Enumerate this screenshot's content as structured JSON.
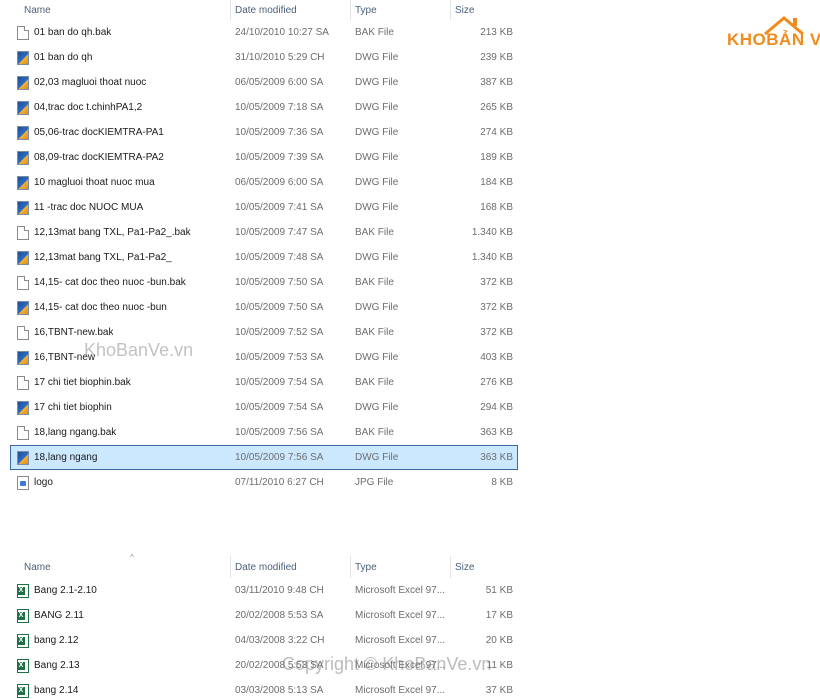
{
  "columns": {
    "name": "Name",
    "date": "Date modified",
    "type": "Type",
    "size": "Size"
  },
  "top_files": [
    {
      "name": "01 ban do qh.bak",
      "date": "24/10/2010 10:27 SA",
      "type": "BAK File",
      "size": "213 KB",
      "icon": "file"
    },
    {
      "name": "01 ban do qh",
      "date": "31/10/2010 5:29 CH",
      "type": "DWG File",
      "size": "239 KB",
      "icon": "dwg"
    },
    {
      "name": "02,03 magluoi thoat nuoc",
      "date": "06/05/2009 6:00 SA",
      "type": "DWG File",
      "size": "387 KB",
      "icon": "dwg"
    },
    {
      "name": "04,trac doc t.chinhPA1,2",
      "date": "10/05/2009 7:18 SA",
      "type": "DWG File",
      "size": "265 KB",
      "icon": "dwg"
    },
    {
      "name": "05,06-trac docKIEMTRA-PA1",
      "date": "10/05/2009 7:36 SA",
      "type": "DWG File",
      "size": "274 KB",
      "icon": "dwg"
    },
    {
      "name": "08,09-trac docKIEMTRA-PA2",
      "date": "10/05/2009 7:39 SA",
      "type": "DWG File",
      "size": "189 KB",
      "icon": "dwg"
    },
    {
      "name": "10 magluoi thoat nuoc mua",
      "date": "06/05/2009 6:00 SA",
      "type": "DWG File",
      "size": "184 KB",
      "icon": "dwg"
    },
    {
      "name": "11 -trac doc NUOC MUA",
      "date": "10/05/2009 7:41 SA",
      "type": "DWG File",
      "size": "168 KB",
      "icon": "dwg"
    },
    {
      "name": "12,13mat bang TXL, Pa1-Pa2_.bak",
      "date": "10/05/2009 7:47 SA",
      "type": "BAK File",
      "size": "1.340 KB",
      "icon": "file"
    },
    {
      "name": "12,13mat bang TXL, Pa1-Pa2_",
      "date": "10/05/2009 7:48 SA",
      "type": "DWG File",
      "size": "1.340 KB",
      "icon": "dwg"
    },
    {
      "name": "14,15- cat doc theo nuoc -bun.bak",
      "date": "10/05/2009 7:50 SA",
      "type": "BAK File",
      "size": "372 KB",
      "icon": "file"
    },
    {
      "name": "14,15- cat doc theo nuoc -bun",
      "date": "10/05/2009 7:50 SA",
      "type": "DWG File",
      "size": "372 KB",
      "icon": "dwg"
    },
    {
      "name": "16,TBNT-new.bak",
      "date": "10/05/2009 7:52 SA",
      "type": "BAK File",
      "size": "372 KB",
      "icon": "file"
    },
    {
      "name": "16,TBNT-new",
      "date": "10/05/2009 7:53 SA",
      "type": "DWG File",
      "size": "403 KB",
      "icon": "dwg"
    },
    {
      "name": "17 chi tiet biophin.bak",
      "date": "10/05/2009 7:54 SA",
      "type": "BAK File",
      "size": "276 KB",
      "icon": "file"
    },
    {
      "name": "17 chi tiet biophin",
      "date": "10/05/2009 7:54 SA",
      "type": "DWG File",
      "size": "294 KB",
      "icon": "dwg"
    },
    {
      "name": "18,lang ngang.bak",
      "date": "10/05/2009 7:56 SA",
      "type": "BAK File",
      "size": "363 KB",
      "icon": "file"
    },
    {
      "name": "18,lang ngang",
      "date": "10/05/2009 7:56 SA",
      "type": "DWG File",
      "size": "363 KB",
      "icon": "dwg",
      "selected": true
    },
    {
      "name": "logo",
      "date": "07/11/2010 6:27 CH",
      "type": "JPG File",
      "size": "8 KB",
      "icon": "jpg"
    }
  ],
  "bottom_files": [
    {
      "name": "Bang 2.1-2.10",
      "date": "03/11/2010 9:48 CH",
      "type": "Microsoft Excel 97...",
      "size": "51 KB",
      "icon": "xls"
    },
    {
      "name": "BANG 2.11",
      "date": "20/02/2008 5:53 SA",
      "type": "Microsoft Excel 97...",
      "size": "17 KB",
      "icon": "xls"
    },
    {
      "name": "bang 2.12",
      "date": "04/03/2008 3:22 CH",
      "type": "Microsoft Excel 97...",
      "size": "20 KB",
      "icon": "xls"
    },
    {
      "name": "Bang 2.13",
      "date": "20/02/2008 5:53 SA",
      "type": "Microsoft Excel 97...",
      "size": "11 KB",
      "icon": "xls"
    },
    {
      "name": "bang 2.14",
      "date": "03/03/2008 5:13 SA",
      "type": "Microsoft Excel 97...",
      "size": "37 KB",
      "icon": "xls"
    }
  ],
  "watermarks": {
    "logo_left": "KHO",
    "logo_right": "BẢN VẼ",
    "middle": "KhoBanVe.vn",
    "bottom": "Copyright © KhoBanVe.vn"
  },
  "colors": {
    "selection": "#cce8ff",
    "accent_orange": "#f08c1e"
  }
}
